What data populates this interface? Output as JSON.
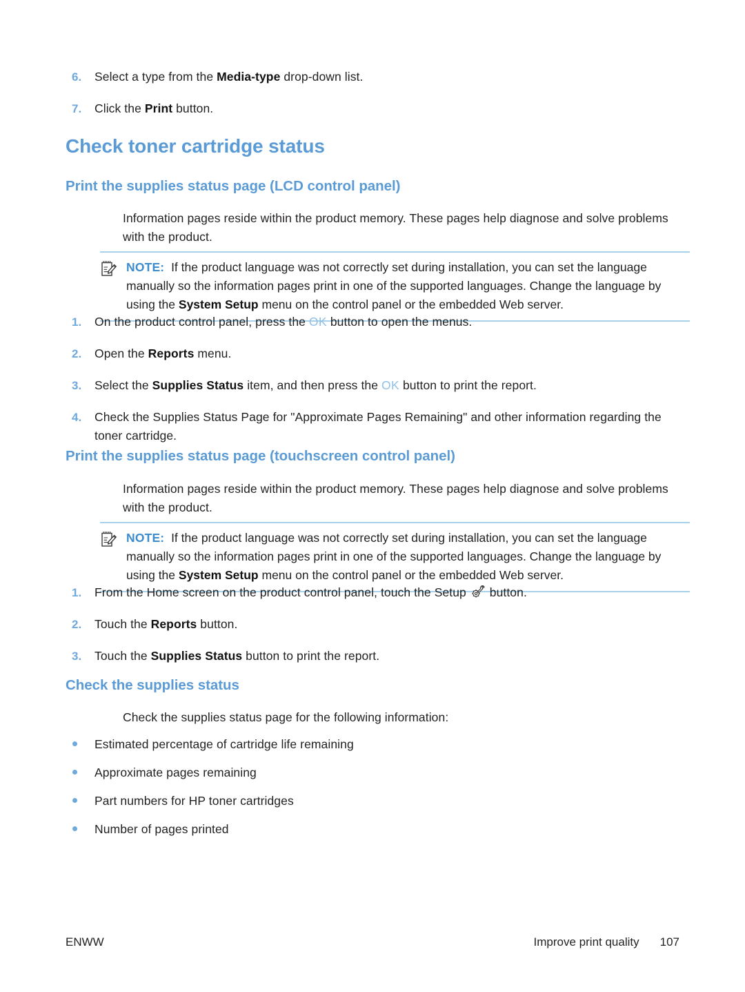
{
  "page": {
    "number": "107",
    "footer_left": "ENWW",
    "footer_right": "Improve print quality"
  },
  "colors": {
    "heading_blue": "#5B9BD5",
    "note_rule_blue": "#A8D2EC",
    "list_number_blue": "#6FA8DC",
    "bullet_blue": "#6FA8DC",
    "ok_key_blue": "#8FC0E8",
    "body_text": "#221f1f"
  },
  "continued_steps": [
    {
      "number": "6.",
      "parts": [
        {
          "t": "Select a type from the ",
          "b": false
        },
        {
          "t": "Media-type",
          "b": true
        },
        {
          "t": " drop-down list.",
          "b": false
        }
      ]
    },
    {
      "number": "7.",
      "parts": [
        {
          "t": "Click the ",
          "b": false
        },
        {
          "t": "Print",
          "b": true
        },
        {
          "t": " button.",
          "b": false
        }
      ]
    }
  ],
  "section_title": "Check toner cartridge status",
  "lcd_section": {
    "heading": "Print the supplies status page (LCD control panel)",
    "intro": "Information pages reside within the product memory. These pages help diagnose and solve problems with the product.",
    "note": {
      "icon": "note-pad-pencil-icon",
      "label": "NOTE:",
      "parts": [
        {
          "t": "If the product language was not correctly set during installation, you can set the language manually so the information pages print in one of the supported languages. Change the language by using the ",
          "b": false
        },
        {
          "t": "System Setup",
          "b": true
        },
        {
          "t": " menu on the control panel or the embedded Web server.",
          "b": false
        }
      ]
    },
    "steps": [
      {
        "number": "1.",
        "parts": [
          {
            "t": "On the product control panel, press the ",
            "b": false
          },
          {
            "t": "OK",
            "b": false,
            "key": true
          },
          {
            "t": " button to open the menus.",
            "b": false
          }
        ]
      },
      {
        "number": "2.",
        "parts": [
          {
            "t": "Open the ",
            "b": false
          },
          {
            "t": "Reports",
            "b": true
          },
          {
            "t": " menu.",
            "b": false
          }
        ]
      },
      {
        "number": "3.",
        "parts": [
          {
            "t": "Select the ",
            "b": false
          },
          {
            "t": "Supplies Status",
            "b": true
          },
          {
            "t": " item, and then press the ",
            "b": false
          },
          {
            "t": "OK",
            "b": false,
            "key": true
          },
          {
            "t": " button to print the report.",
            "b": false
          }
        ]
      },
      {
        "number": "4.",
        "parts": [
          {
            "t": "Check the Supplies Status Page for \"Approximate Pages Remaining\" and other information regarding the toner cartridge.",
            "b": false
          }
        ]
      }
    ]
  },
  "touchscreen_section": {
    "heading": "Print the supplies status page (touchscreen control panel)",
    "intro": "Information pages reside within the product memory. These pages help diagnose and solve problems with the product.",
    "note": {
      "icon": "note-pad-pencil-icon",
      "label": "NOTE:",
      "parts": [
        {
          "t": "If the product language was not correctly set during installation, you can set the language manually so the information pages print in one of the supported languages. Change the language by using the ",
          "b": false
        },
        {
          "t": "System Setup",
          "b": true
        },
        {
          "t": " menu on the control panel or the embedded Web server.",
          "b": false
        }
      ]
    },
    "steps": [
      {
        "number": "1.",
        "parts": [
          {
            "t": "From the Home screen on the product control panel, touch the Setup ",
            "b": false
          },
          {
            "t": "",
            "b": false,
            "glyph": "setup-wrench-gear-icon"
          },
          {
            "t": " button.",
            "b": false
          }
        ]
      },
      {
        "number": "2.",
        "parts": [
          {
            "t": "Touch the ",
            "b": false
          },
          {
            "t": "Reports",
            "b": true
          },
          {
            "t": " button.",
            "b": false
          }
        ]
      },
      {
        "number": "3.",
        "parts": [
          {
            "t": "Touch the ",
            "b": false
          },
          {
            "t": "Supplies Status",
            "b": true
          },
          {
            "t": " button to print the report.",
            "b": false
          }
        ]
      }
    ]
  },
  "supplies_status_section": {
    "heading": "Check the supplies status",
    "intro": "Check the supplies status page for the following information:",
    "bullets": [
      "Estimated percentage of cartridge life remaining",
      "Approximate pages remaining",
      "Part numbers for HP toner cartridges",
      "Number of pages printed"
    ]
  }
}
